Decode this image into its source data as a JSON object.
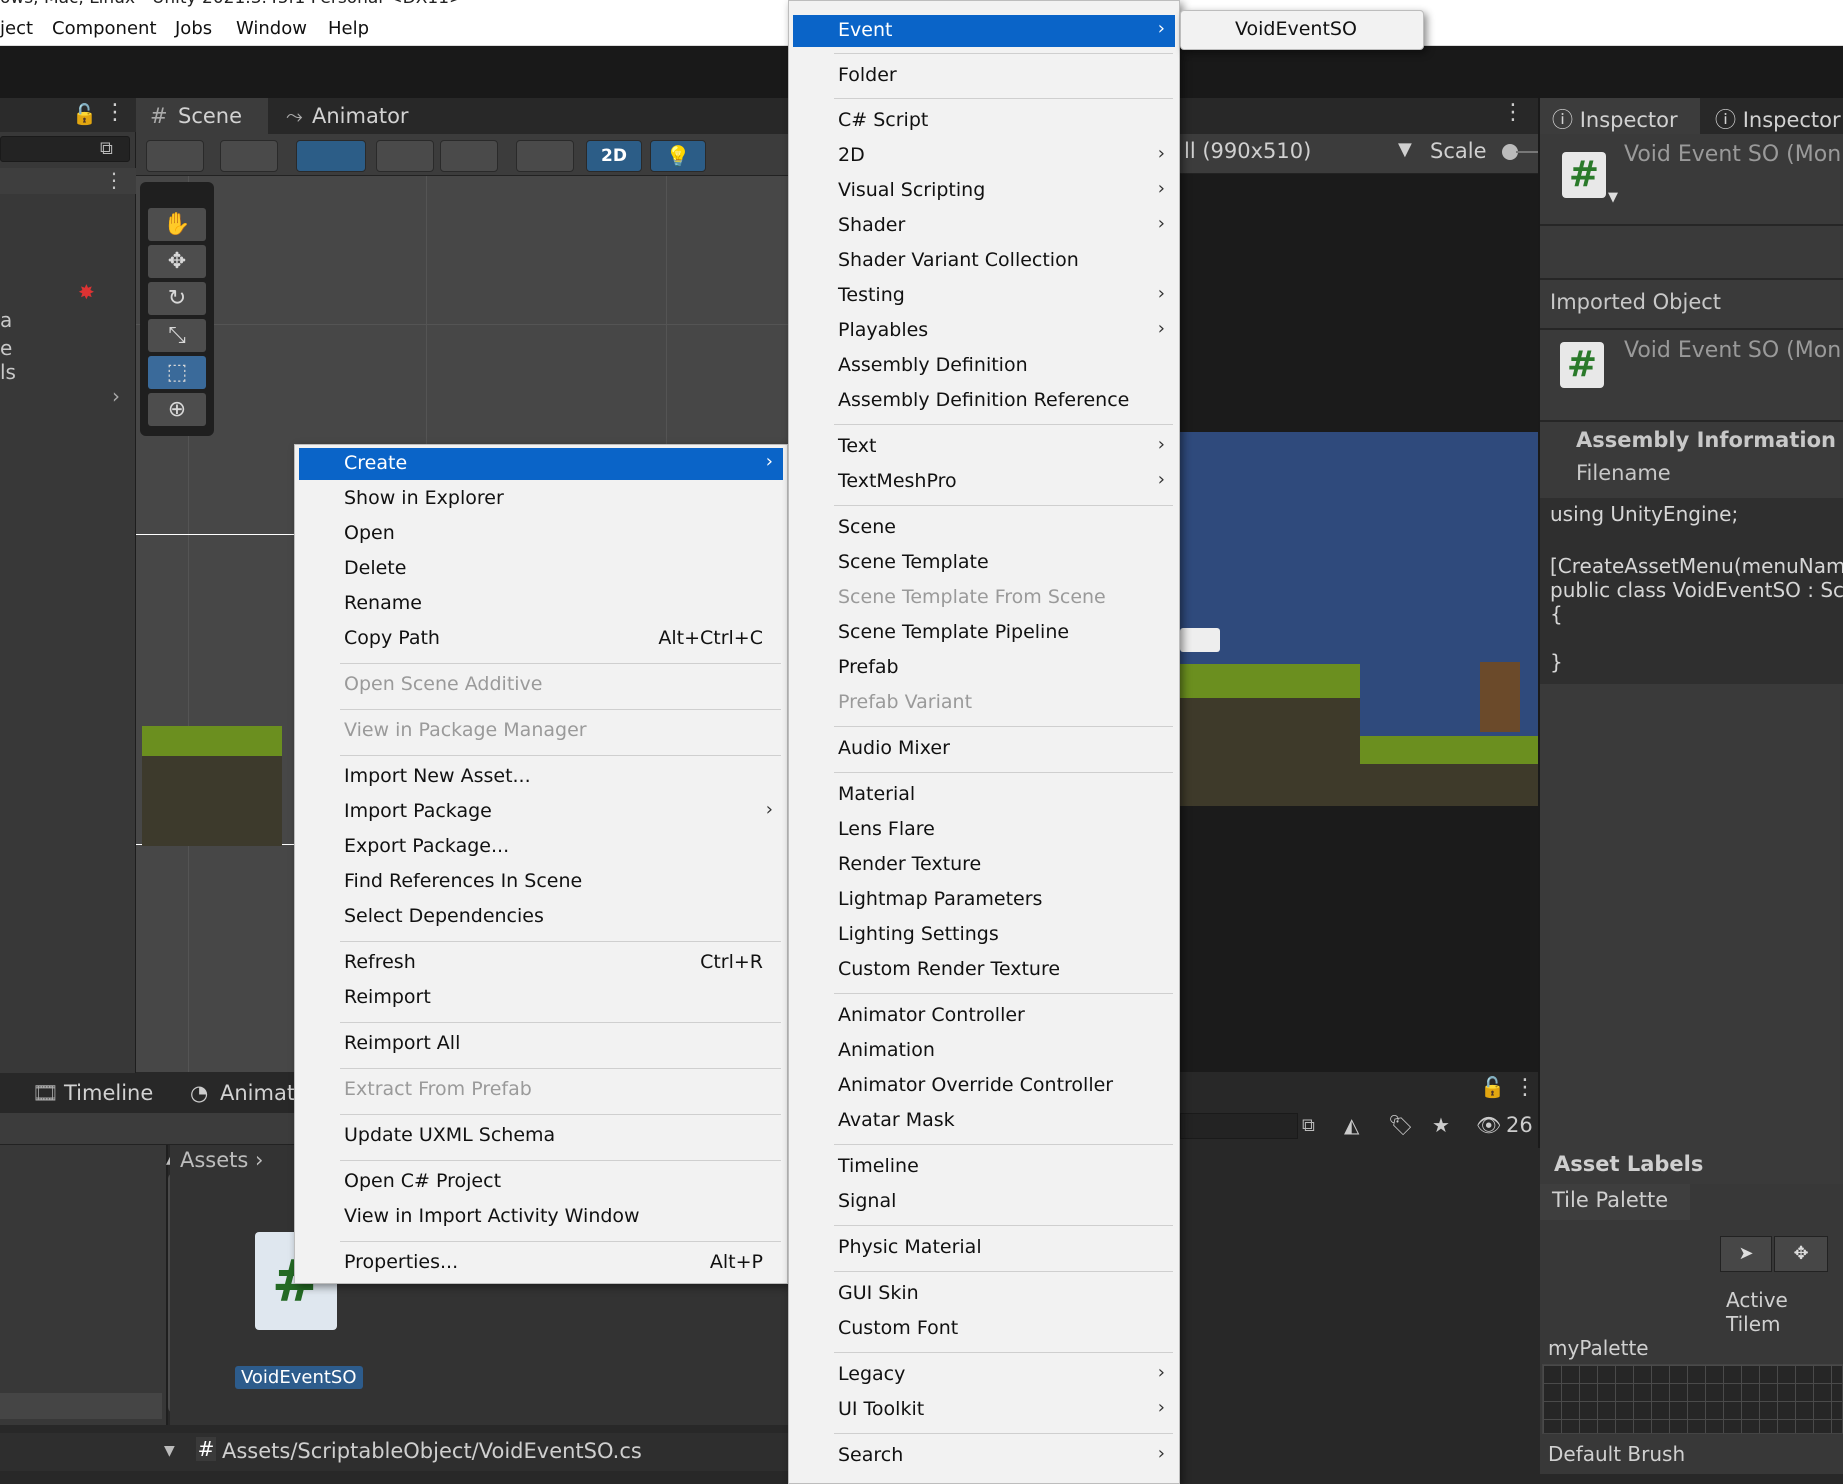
{
  "window_title": "ows, Mac, Linux - Unity 2021.3.45f1 Personal <DX11>",
  "menubar": [
    "ject",
    "Component",
    "Jobs",
    "Window",
    "Help"
  ],
  "scene_tabs": {
    "scene": "Scene",
    "animator": "Animator"
  },
  "scene_toolbar": {
    "mode_2d": "2D"
  },
  "game_view": {
    "resolution": "ll (990x510)",
    "scale_label": "Scale"
  },
  "inspector": {
    "tab1": "Inspector",
    "tab2": "Inspector",
    "title_top": "Void Event SO (Mon",
    "imported_object": "Imported Object",
    "title_imported": "Void Event SO (Mon",
    "assembly_info": "Assembly Information",
    "filename": "Filename",
    "code": [
      "using UnityEngine;",
      "",
      "[CreateAssetMenu(menuName",
      "public class VoidEventSO : Scr",
      "{",
      "",
      "}"
    ]
  },
  "hierarchy": {
    "left_labels": [
      "a",
      "e",
      "ls"
    ]
  },
  "bottom_tabs": {
    "timeline": "Timeline",
    "animation": "Animati"
  },
  "project": {
    "breadcrumb": "Assets",
    "asset_name": "VoidEventSO",
    "path": "Assets/ScriptableObject/VoidEventSO.cs",
    "count": "26"
  },
  "asset_labels": "Asset Labels",
  "tile_palette": {
    "tab": "Tile Palette",
    "active_tilemap": "Active Tilem",
    "palette": "myPalette",
    "brush": "Default Brush"
  },
  "context_menu": {
    "items": [
      {
        "label": "Create",
        "highlighted": true,
        "submenu": true
      },
      {
        "label": "Show in Explorer"
      },
      {
        "label": "Open"
      },
      {
        "label": "Delete"
      },
      {
        "label": "Rename"
      },
      {
        "label": "Copy Path",
        "shortcut": "Alt+Ctrl+C"
      },
      {
        "label": "Open Scene Additive",
        "disabled": true
      },
      {
        "label": "View in Package Manager",
        "disabled": true
      },
      {
        "label": "Import New Asset..."
      },
      {
        "label": "Import Package",
        "submenu": true
      },
      {
        "label": "Export Package..."
      },
      {
        "label": "Find References In Scene"
      },
      {
        "label": "Select Dependencies"
      },
      {
        "label": "Refresh",
        "shortcut": "Ctrl+R"
      },
      {
        "label": "Reimport"
      },
      {
        "label": "Reimport All"
      },
      {
        "label": "Extract From Prefab",
        "disabled": true
      },
      {
        "label": "Update UXML Schema"
      },
      {
        "label": "Open C# Project"
      },
      {
        "label": "View in Import Activity Window"
      },
      {
        "label": "Properties...",
        "shortcut": "Alt+P"
      }
    ]
  },
  "create_menu": {
    "items": [
      {
        "label": "Event",
        "highlighted": true,
        "submenu": true
      },
      {
        "label": "Folder"
      },
      {
        "label": "C# Script"
      },
      {
        "label": "2D",
        "submenu": true
      },
      {
        "label": "Visual Scripting",
        "submenu": true
      },
      {
        "label": "Shader",
        "submenu": true
      },
      {
        "label": "Shader Variant Collection"
      },
      {
        "label": "Testing",
        "submenu": true
      },
      {
        "label": "Playables",
        "submenu": true
      },
      {
        "label": "Assembly Definition"
      },
      {
        "label": "Assembly Definition Reference"
      },
      {
        "label": "Text",
        "submenu": true
      },
      {
        "label": "TextMeshPro",
        "submenu": true
      },
      {
        "label": "Scene"
      },
      {
        "label": "Scene Template"
      },
      {
        "label": "Scene Template From Scene",
        "disabled": true
      },
      {
        "label": "Scene Template Pipeline"
      },
      {
        "label": "Prefab"
      },
      {
        "label": "Prefab Variant",
        "disabled": true
      },
      {
        "label": "Audio Mixer"
      },
      {
        "label": "Material"
      },
      {
        "label": "Lens Flare"
      },
      {
        "label": "Render Texture"
      },
      {
        "label": "Lightmap Parameters"
      },
      {
        "label": "Lighting Settings"
      },
      {
        "label": "Custom Render Texture"
      },
      {
        "label": "Animator Controller"
      },
      {
        "label": "Animation"
      },
      {
        "label": "Animator Override Controller"
      },
      {
        "label": "Avatar Mask"
      },
      {
        "label": "Timeline"
      },
      {
        "label": "Signal"
      },
      {
        "label": "Physic Material"
      },
      {
        "label": "GUI Skin"
      },
      {
        "label": "Custom Font"
      },
      {
        "label": "Legacy",
        "submenu": true
      },
      {
        "label": "UI Toolkit",
        "submenu": true
      },
      {
        "label": "Search",
        "submenu": true
      }
    ]
  },
  "event_submenu": {
    "items": [
      {
        "label": "VoidEventSO"
      }
    ]
  }
}
